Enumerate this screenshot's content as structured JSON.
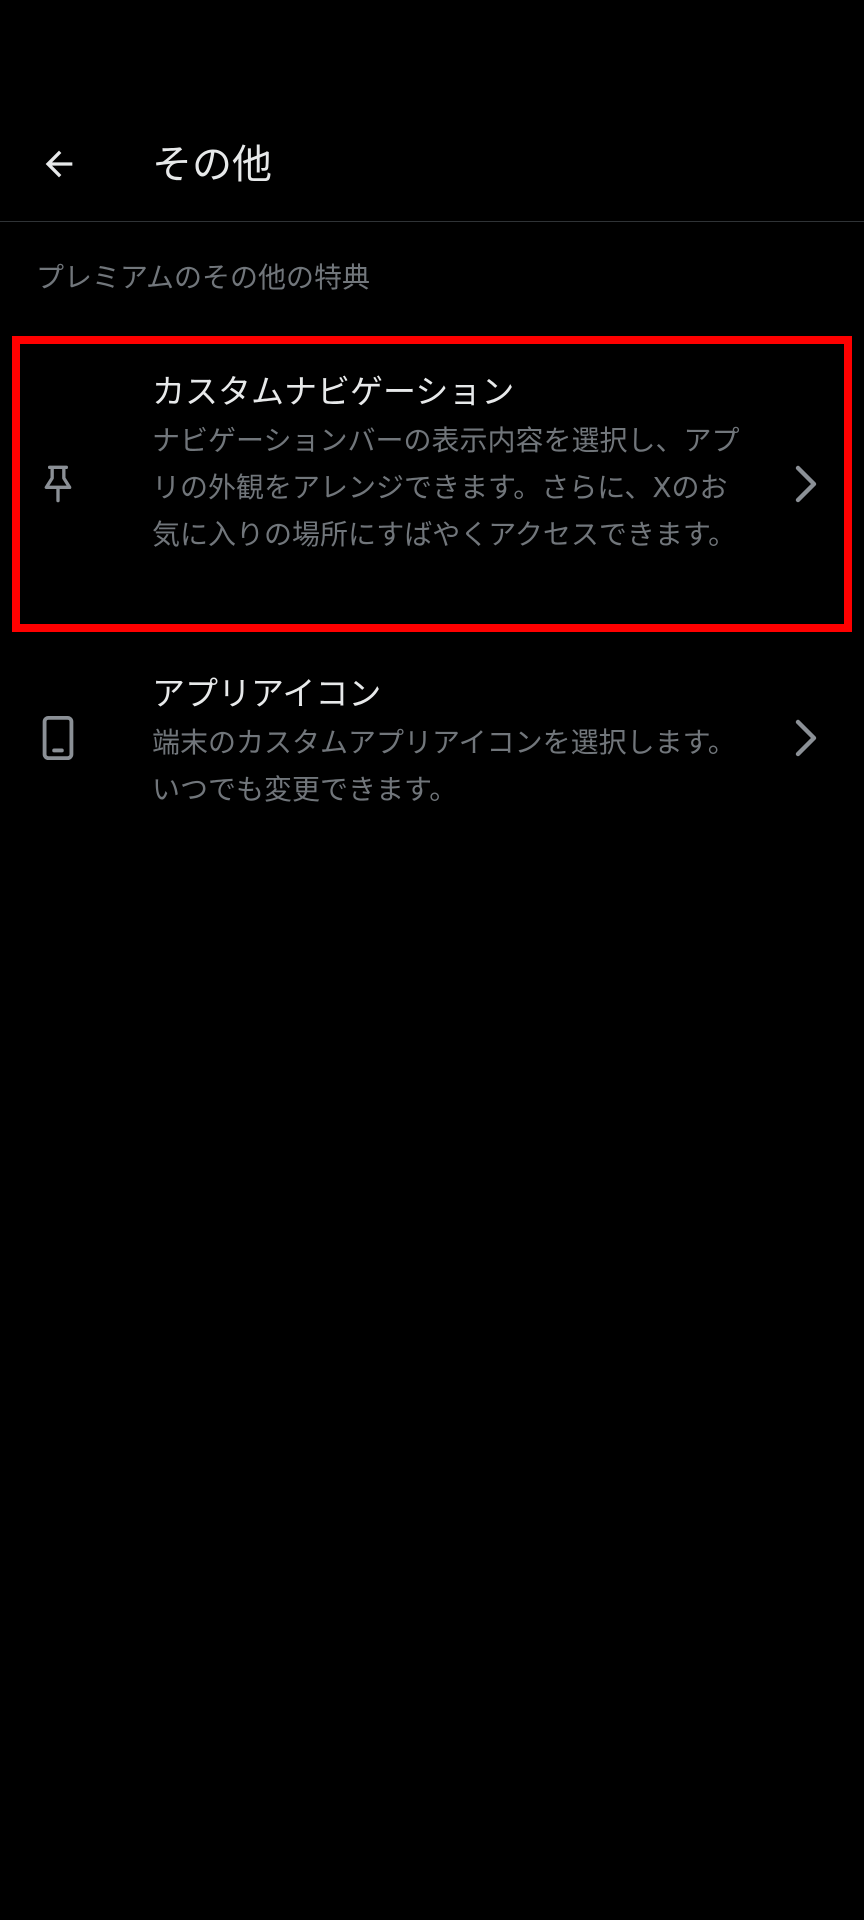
{
  "header": {
    "title": "その他",
    "back_icon": "arrow-left-icon"
  },
  "section": {
    "title": "プレミアムのその他の特典"
  },
  "items": [
    {
      "icon": "pin-icon",
      "title": "カスタムナビゲーション",
      "description": "ナビゲーションバーの表示内容を選択し、アプリの外観をアレンジできます。さらに、Xのお気に入りの場所にすばやくアクセスできます。",
      "chevron": "chevron-right-icon",
      "highlighted": true
    },
    {
      "icon": "phone-icon",
      "title": "アプリアイコン",
      "description": "端末のカスタムアプリアイコンを選択します。いつでも変更できます。",
      "chevron": "chevron-right-icon",
      "highlighted": false
    }
  ],
  "colors": {
    "background": "#000000",
    "primary_text": "#e7e9ea",
    "secondary_text": "#71767b",
    "divider": "#2f3336",
    "highlight": "#ff0000"
  }
}
